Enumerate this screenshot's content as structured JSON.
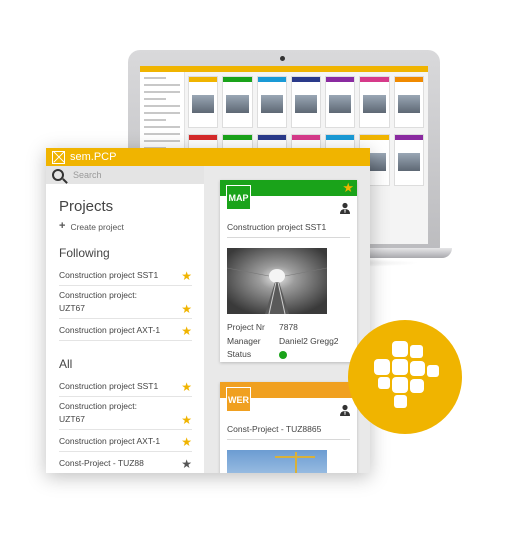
{
  "app": {
    "name": "sem.PCP"
  },
  "search": {
    "placeholder": "Search"
  },
  "sidebar": {
    "title": "Projects",
    "create_label": "Create project",
    "following_title": "Following",
    "following": [
      {
        "label": "Construction project SST1",
        "starred": true
      },
      {
        "label_line1": "Construction project:",
        "label_line2": "UZT67",
        "starred": true
      },
      {
        "label": "Construction project AXT-1",
        "starred": true
      }
    ],
    "all_title": "All",
    "all": [
      {
        "label": "Construction project SST1",
        "starred": true
      },
      {
        "label_line1": "Construction project:",
        "label_line2": "UZT67",
        "starred": true
      },
      {
        "label": "Construction project AXT-1",
        "starred": true
      },
      {
        "label": "Const-Project - TUZ88",
        "starred": false
      }
    ]
  },
  "cards": [
    {
      "badge": "MAP",
      "header_color": "#1aa31a",
      "title": "Construction project SST1",
      "project_nr_label": "Project Nr",
      "project_nr": "7878",
      "manager_label": "Manager",
      "manager": "Daniel2 Gregg2",
      "status_label": "Status",
      "status_color": "#1aa31a"
    },
    {
      "badge": "WER",
      "header_color": "#f0a020",
      "title": "Const-Project - TUZ8865"
    }
  ],
  "icons": {
    "logo": "logo-icon",
    "search": "search-icon",
    "plus": "plus-icon",
    "star": "star-icon",
    "avatar": "avatar-icon",
    "brand": "brand-logo-icon"
  },
  "colors": {
    "brand": "#f0b400",
    "star_active": "#f0b400",
    "star_inactive": "#555555"
  }
}
